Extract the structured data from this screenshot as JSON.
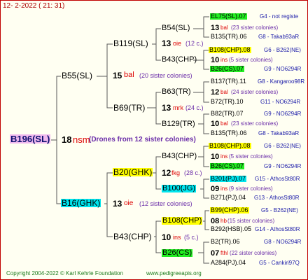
{
  "header": {
    "date": "12-  2-2022 ( 21: 31)"
  },
  "footer": {
    "copyright": "Copyright 2004-2022 © Karl Kehrle Foundation",
    "site": "www.pedigreeapis.org"
  },
  "colors": {
    "yellow": "#ffff00",
    "green": "#22ee22",
    "cyan": "#00e5ee",
    "pink": "#f0b8ee",
    "border": "#c00000",
    "line": "#5a5a5a"
  },
  "root": {
    "id": "B196(SL)",
    "num": "18",
    "code": "nsm",
    "note": "(Drones from 12 sister colonies)"
  },
  "gen1": [
    {
      "id": "B55(SL)",
      "num": "15",
      "code": "bal",
      "note": "(20 sister colonies)"
    },
    {
      "id": "B16(GHK)",
      "num": "13",
      "code": "oie",
      "note": "(12 sister colonies)"
    }
  ],
  "gen2": [
    {
      "id": "B119(SL)",
      "num": "13",
      "code": "oie",
      "note": "(12 c.)"
    },
    {
      "id": "B69(TR)",
      "num": "13",
      "code": "mrk",
      "note": "(24 c.)"
    },
    {
      "id": "B20(GHK)",
      "num": "12",
      "code": "fkg",
      "note": "(28 c.)"
    },
    {
      "id": "B43(CHP)",
      "num": "10",
      "code": "ins",
      "note": "(5 c.)"
    }
  ],
  "gen3": [
    {
      "id": "B54(SL)",
      "num": "13",
      "code": "bal",
      "note": "(23 sister colonies)"
    },
    {
      "id": "B43(CHP)",
      "num": "10",
      "code": "ins",
      "note": "(5 sister colonies)"
    },
    {
      "id": "B63(TR)",
      "num": "12",
      "code": "bal",
      "note": "(24 sister colonies)"
    },
    {
      "id": "B129(TR)",
      "num": "10",
      "code": "bal",
      "note": "(23 sister colonies)"
    },
    {
      "id": "B43(CHP)",
      "num": "10",
      "code": "ins",
      "note": "(5 sister colonies)"
    },
    {
      "id": "B100(JG)",
      "num": "09",
      "code": "ins",
      "note": "(9 sister colonies)"
    },
    {
      "id": "B108(CHP)",
      "num": "08",
      "code": "hb",
      "note": "(15 sister colonies)"
    },
    {
      "id": "B26(CS)",
      "num": "07",
      "code": "fthl",
      "note": "(22 sister colonies)"
    }
  ],
  "gen4": [
    {
      "id": "EL75(SL).07",
      "breeder": "G4 - not registe"
    },
    {
      "id": "B135(TR).06",
      "breeder": "G8 - Takab93aR"
    },
    {
      "id": "B108(CHP).08",
      "breeder": "G6 - B262(NE)"
    },
    {
      "id": "B26(CS).07",
      "breeder": "G9 - NO6294R"
    },
    {
      "id": "B137(TR).11",
      "breeder": "G8 - Kangaroo98R"
    },
    {
      "id": "B72(TR).10",
      "breeder": "G11 - NO6294R"
    },
    {
      "id": "B82(TR).07",
      "breeder": "G9 - NO6294R"
    },
    {
      "id": "B135(TR).06",
      "breeder": "G8 - Takab93aR"
    },
    {
      "id": "B108(CHP).08",
      "breeder": "G6 - B262(NE)"
    },
    {
      "id": "B26(CS).07",
      "breeder": "G9 - NO6294R"
    },
    {
      "id": "B201(PJ).07",
      "breeder": "G15 - AthosSt80R"
    },
    {
      "id": "B271(PJ).04",
      "breeder": "G13 - AthosSt80R"
    },
    {
      "id": "B99(CHP).06",
      "breeder": "G5 - B262(NE)"
    },
    {
      "id": "B292(HSB).05",
      "breeder": "G14 - AthosSt80R"
    },
    {
      "id": "B2(TR).06",
      "breeder": "G8 - NO6294R"
    },
    {
      "id": "A284(PJ).04",
      "breeder": "G5 - Cankiri97Q"
    }
  ]
}
